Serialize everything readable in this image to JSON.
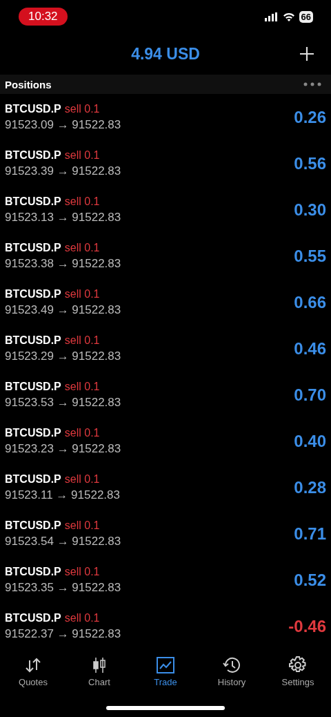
{
  "status_bar": {
    "time": "10:32",
    "battery": "66"
  },
  "header": {
    "balance": "4.94 USD"
  },
  "section": {
    "title": "Positions"
  },
  "positions": [
    {
      "symbol": "BTCUSD.P",
      "order": "sell 0.1",
      "prices": "91523.09 → 91522.83",
      "profit": "0.26",
      "kind": "profit"
    },
    {
      "symbol": "BTCUSD.P",
      "order": "sell 0.1",
      "prices": "91523.39 → 91522.83",
      "profit": "0.56",
      "kind": "profit"
    },
    {
      "symbol": "BTCUSD.P",
      "order": "sell 0.1",
      "prices": "91523.13 → 91522.83",
      "profit": "0.30",
      "kind": "profit"
    },
    {
      "symbol": "BTCUSD.P",
      "order": "sell 0.1",
      "prices": "91523.38 → 91522.83",
      "profit": "0.55",
      "kind": "profit"
    },
    {
      "symbol": "BTCUSD.P",
      "order": "sell 0.1",
      "prices": "91523.49 → 91522.83",
      "profit": "0.66",
      "kind": "profit"
    },
    {
      "symbol": "BTCUSD.P",
      "order": "sell 0.1",
      "prices": "91523.29 → 91522.83",
      "profit": "0.46",
      "kind": "profit"
    },
    {
      "symbol": "BTCUSD.P",
      "order": "sell 0.1",
      "prices": "91523.53 → 91522.83",
      "profit": "0.70",
      "kind": "profit"
    },
    {
      "symbol": "BTCUSD.P",
      "order": "sell 0.1",
      "prices": "91523.23 → 91522.83",
      "profit": "0.40",
      "kind": "profit"
    },
    {
      "symbol": "BTCUSD.P",
      "order": "sell 0.1",
      "prices": "91523.11 → 91522.83",
      "profit": "0.28",
      "kind": "profit"
    },
    {
      "symbol": "BTCUSD.P",
      "order": "sell 0.1",
      "prices": "91523.54 → 91522.83",
      "profit": "0.71",
      "kind": "profit"
    },
    {
      "symbol": "BTCUSD.P",
      "order": "sell 0.1",
      "prices": "91523.35 → 91522.83",
      "profit": "0.52",
      "kind": "profit"
    },
    {
      "symbol": "BTCUSD.P",
      "order": "sell 0.1",
      "prices": "91522.37 → 91522.83",
      "profit": "-0.46",
      "kind": "loss"
    }
  ],
  "tab_bar": [
    {
      "label": "Quotes",
      "selected": false,
      "kind": "arrows"
    },
    {
      "label": "Chart",
      "selected": false,
      "kind": "candles"
    },
    {
      "label": "Trade",
      "selected": true,
      "kind": "trend"
    },
    {
      "label": "History",
      "selected": false,
      "kind": "clock"
    },
    {
      "label": "Settings",
      "selected": false,
      "kind": "gear"
    }
  ]
}
